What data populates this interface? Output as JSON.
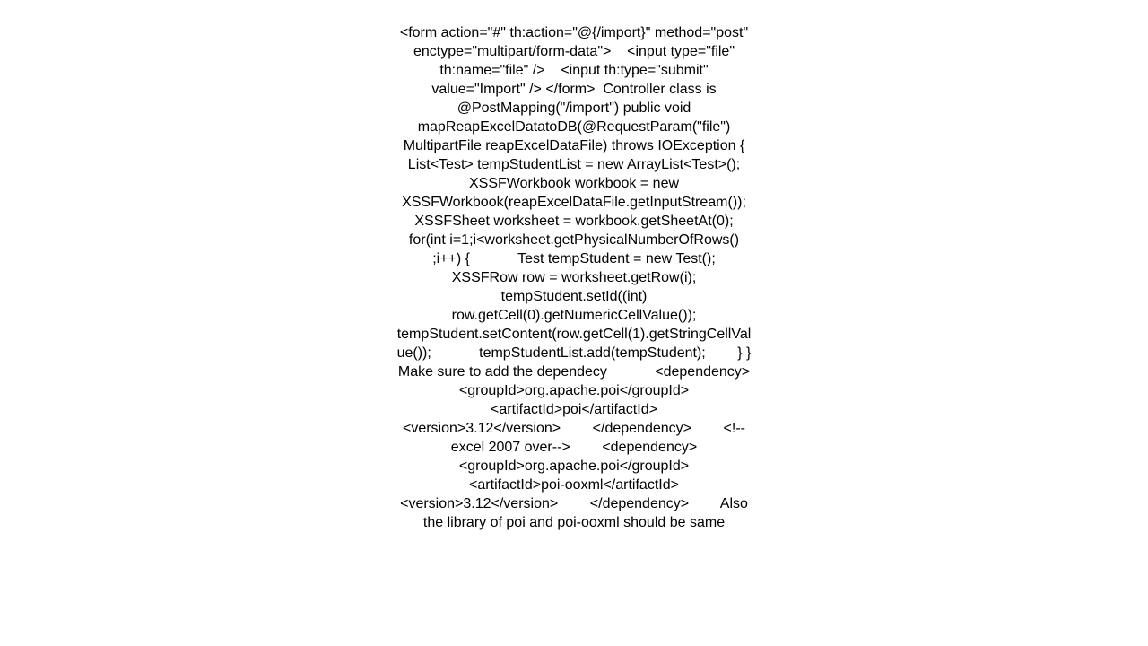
{
  "page": {
    "background_color": "#ffffff",
    "text_color": "#000000",
    "alignment": "center"
  },
  "content": {
    "body_text": "<form action=\"#\" th:action=\"@{/import}\" method=\"post\" enctype=\"multipart/form-data\">    <input type=\"file\" th:name=\"file\" />    <input th:type=\"submit\" value=\"Import\" /> </form>  Controller class is  @PostMapping(\"/import\") public void mapReapExcelDatatoDB(@RequestParam(\"file\") MultipartFile reapExcelDataFile) throws IOException {        List<Test> tempStudentList = new ArrayList<Test>();        XSSFWorkbook workbook = new XSSFWorkbook(reapExcelDataFile.getInputStream());        XSSFSheet worksheet = workbook.getSheetAt(0);         for(int i=1;i<worksheet.getPhysicalNumberOfRows() ;i++) {            Test tempStudent = new Test();            XSSFRow row = worksheet.getRow(i);            tempStudent.setId((int) row.getCell(0).getNumericCellValue());            tempStudent.setContent(row.getCell(1).getStringCellValue());            tempStudentList.add(tempStudent);        } }  Make sure to add the dependecy            <dependency>            <groupId>org.apache.poi</groupId>            <artifactId>poi</artifactId>            <version>3.12</version>        </dependency>        <!-- excel 2007 over-->        <dependency>            <groupId>org.apache.poi</groupId>            <artifactId>poi-ooxml</artifactId>            <version>3.12</version>        </dependency>        Also the library of poi and poi-ooxml should be same"
  },
  "visible_lines": [
    "th:action=\"@{/import}\" method=\"post\"",
    "enctype=\"multipart/form-data\">",
    "<input type=\"file\" th:name=\"file\" />",
    "<input th:type=\"submit\" value=\"Import\"",
    "/> </form>  Controller class is",
    "@PostMapping(\"/import\") public void mapR",
    "eapExcelDatatoDB(@RequestParam(\"file\")",
    "MultipartFile reapExcelDataFile) throws",
    "IOException {        List<Test>",
    "tempStudentList = new ArrayList<Test>();",
    "XSSFWorkbook workbook = new XSSFWorkbook",
    "(reapExcelDataFile.getInputStream());",
    "XSSFSheet worksheet =",
    "workbook.getSheetAt(0);         for(int",
    "i=1;i<worksheet.getPhysicalNumberOfRows(",
    ") ;i++) {        Test tempStudent = new",
    "Test();                XSSFRow row",
    "= worksheet.getRow(i);",
    "tempStudent.setId((int)",
    "row.getCell(0).getNumericCellValue());",
    "tempStudent.setContent(row.getCell(1).ge",
    "tStringCellValue());",
    "tempStudentList.add(tempStudent);",
    "} }  Make sure to add the dependecy",
    "<dependency>",
    "<groupId>org.apache.poi</groupId>",
    "<artifactId>poi</artifactId>",
    "<version>3.12</version> </dependency>",
    "<!-- excel 2007 over--> <dependency>",
    "<groupId>org.apache.poi</groupId>",
    "<artifactId>poi-ooxml</artifactId>",
    "<version>3.12</version> </dependency>"
  ]
}
